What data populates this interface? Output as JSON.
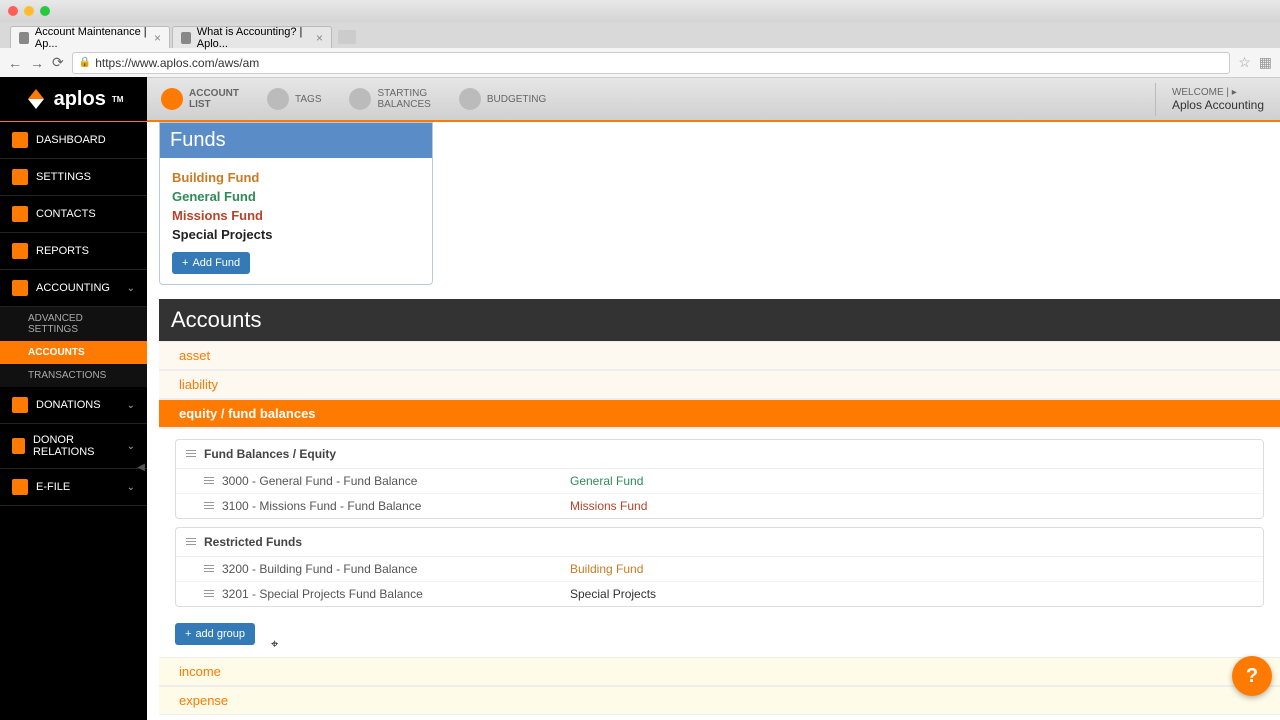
{
  "browser": {
    "tabs": [
      {
        "title": "Account Maintenance | Ap..."
      },
      {
        "title": "What is Accounting? | Aplo..."
      }
    ],
    "url": "https://www.aplos.com/aws/am"
  },
  "logo_text": "aplos",
  "logo_tm": "TM",
  "topnav": {
    "items": [
      {
        "label": "ACCOUNT\nLIST"
      },
      {
        "label": "TAGS"
      },
      {
        "label": "STARTING\nBALANCES"
      },
      {
        "label": "BUDGETING"
      }
    ],
    "welcome_label": "WELCOME |",
    "welcome_caret": "▸",
    "app_name": "Aplos Accounting"
  },
  "sidebar": {
    "items": [
      {
        "label": "DASHBOARD"
      },
      {
        "label": "SETTINGS"
      },
      {
        "label": "CONTACTS"
      },
      {
        "label": "REPORTS"
      },
      {
        "label": "ACCOUNTING",
        "expandable": true,
        "children": [
          {
            "label": "ADVANCED SETTINGS"
          },
          {
            "label": "ACCOUNTS",
            "active": true
          },
          {
            "label": "TRANSACTIONS"
          }
        ]
      },
      {
        "label": "DONATIONS",
        "expandable": true
      },
      {
        "label": "DONOR RELATIONS",
        "expandable": true
      },
      {
        "label": "E-FILE",
        "expandable": true
      }
    ]
  },
  "funds": {
    "title": "Funds",
    "items": [
      {
        "name": "Building Fund",
        "colorClass": "fund-orange"
      },
      {
        "name": "General Fund",
        "colorClass": "fund-green"
      },
      {
        "name": "Missions Fund",
        "colorClass": "fund-red"
      },
      {
        "name": "Special Projects",
        "colorClass": "fund-black"
      }
    ],
    "add_label": "Add Fund"
  },
  "accounts": {
    "title": "Accounts",
    "categories": {
      "asset": "asset",
      "liability": "liability",
      "equity": "equity / fund balances",
      "income": "income",
      "expense": "expense"
    },
    "equity": {
      "groups": [
        {
          "name": "Fund Balances / Equity",
          "rows": [
            {
              "name": "3000 - General Fund - Fund Balance",
              "fund": "General Fund",
              "fundClass": "green"
            },
            {
              "name": "3100 - Missions Fund - Fund Balance",
              "fund": "Missions Fund",
              "fundClass": "red"
            }
          ]
        },
        {
          "name": "Restricted Funds",
          "rows": [
            {
              "name": "3200 - Building Fund - Fund Balance",
              "fund": "Building Fund",
              "fundClass": "orange"
            },
            {
              "name": "3201 - Special Projects Fund Balance",
              "fund": "Special Projects",
              "fundClass": "black"
            }
          ]
        }
      ],
      "add_group_label": "add group"
    }
  },
  "help_glyph": "?"
}
